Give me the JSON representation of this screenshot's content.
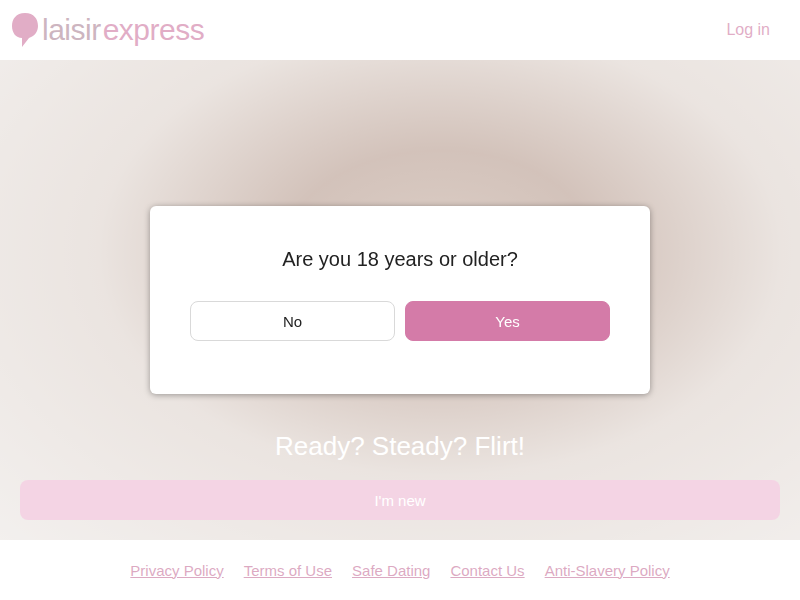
{
  "header": {
    "logo": [
      "laisir",
      "express"
    ],
    "login": "Log in"
  },
  "hero": {
    "tagline": "Ready? Steady? Flirt!",
    "button": "I'm new"
  },
  "footer": {
    "links": [
      "Privacy Policy",
      "Terms of Use",
      "Safe Dating",
      "Contact Us",
      "Anti-Slavery Policy"
    ]
  },
  "dialog": {
    "question": "Are you 18 years or older?",
    "buttons": [
      {
        "label": "No",
        "selected": false
      },
      {
        "label": "Yes",
        "selected": true
      }
    ]
  }
}
